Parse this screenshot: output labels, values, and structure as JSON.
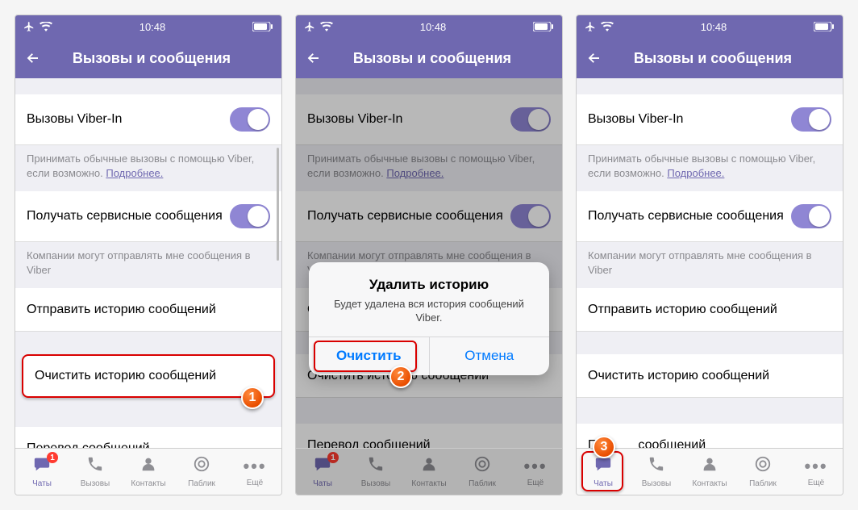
{
  "status": {
    "time": "10:48"
  },
  "nav": {
    "title": "Вызовы и сообщения"
  },
  "rows": {
    "viber_in": "Вызовы Viber-In",
    "viber_in_desc_1": "Принимать обычные вызовы с помощью Viber, если возможно. ",
    "more": "Подробнее.",
    "service_msgs": "Получать сервисные сообщения",
    "service_desc": "Компании могут отправлять мне сообщения в Viber",
    "send_history": "Отправить историю сообщений",
    "clear_history": "Очистить историю сообщений",
    "translate": "Перевод сообщений",
    "translate_prefix": "Пе",
    "translate_suffix": "сообщений"
  },
  "alert": {
    "title": "Удалить историю",
    "msg": "Будет удалена вся история сообщений Viber.",
    "clear": "Очистить",
    "cancel": "Отмена"
  },
  "tabs": {
    "chats": "Чаты",
    "calls": "Вызовы",
    "contacts": "Контакты",
    "public": "Паблик",
    "more": "Ещё",
    "badge": "1"
  },
  "steps": {
    "s1": "1",
    "s2": "2",
    "s3": "3"
  }
}
